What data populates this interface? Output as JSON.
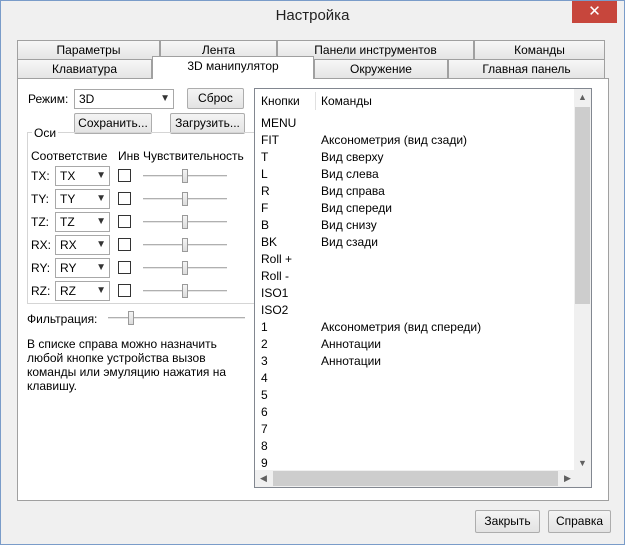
{
  "window": {
    "title": "Настройка",
    "close_glyph": "✕"
  },
  "tabs": {
    "row1": [
      "Параметры",
      "Лента",
      "Панели инструментов",
      "Команды"
    ],
    "row2": [
      "Клавиатура",
      "3D манипулятор",
      "Окружение",
      "Главная панель"
    ],
    "active": "3D манипулятор"
  },
  "mode": {
    "label": "Режим:",
    "value": "3D",
    "reset": "Сброс",
    "save": "Сохранить...",
    "load": "Загрузить..."
  },
  "axes": {
    "group_title": "Оси",
    "col_mapping": "Соответствие",
    "col_invert": "Инв",
    "col_sensitivity": "Чувствительность",
    "rows": [
      {
        "label": "TX:",
        "value": "TX",
        "inverted": false,
        "sensitivity": 0.5
      },
      {
        "label": "TY:",
        "value": "TY",
        "inverted": false,
        "sensitivity": 0.5
      },
      {
        "label": "TZ:",
        "value": "TZ",
        "inverted": false,
        "sensitivity": 0.5
      },
      {
        "label": "RX:",
        "value": "RX",
        "inverted": false,
        "sensitivity": 0.5
      },
      {
        "label": "RY:",
        "value": "RY",
        "inverted": false,
        "sensitivity": 0.5
      },
      {
        "label": "RZ:",
        "value": "RZ",
        "inverted": false,
        "sensitivity": 0.5
      }
    ]
  },
  "filter": {
    "label": "Фильтрация:",
    "level": 0.15
  },
  "info_text": "В списке справа можно назначить любой кнопке устройства вызов команды или эмуляцию нажатия на клавишу.",
  "list": {
    "col_buttons": "Кнопки",
    "col_commands": "Команды",
    "rows": [
      {
        "k": "MENU",
        "c": ""
      },
      {
        "k": "FIT",
        "c": "Аксонометрия (вид сзади)"
      },
      {
        "k": "T",
        "c": "Вид сверху"
      },
      {
        "k": "L",
        "c": "Вид слева"
      },
      {
        "k": "R",
        "c": "Вид справа"
      },
      {
        "k": "F",
        "c": "Вид спереди"
      },
      {
        "k": "B",
        "c": "Вид снизу"
      },
      {
        "k": "BK",
        "c": "Вид сзади"
      },
      {
        "k": "Roll +",
        "c": ""
      },
      {
        "k": "Roll -",
        "c": ""
      },
      {
        "k": "ISO1",
        "c": ""
      },
      {
        "k": "ISO2",
        "c": ""
      },
      {
        "k": "1",
        "c": "Аксонометрия (вид спереди)"
      },
      {
        "k": "2",
        "c": "Аннотации"
      },
      {
        "k": "3",
        "c": "Аннотации"
      },
      {
        "k": "4",
        "c": ""
      },
      {
        "k": "5",
        "c": ""
      },
      {
        "k": "6",
        "c": ""
      },
      {
        "k": "7",
        "c": ""
      },
      {
        "k": "8",
        "c": ""
      },
      {
        "k": "9",
        "c": ""
      }
    ]
  },
  "footer": {
    "close": "Закрыть",
    "help": "Справка"
  },
  "icons": {
    "dropdown": "chevron-down-icon",
    "scroll_up": "arrow-up-icon",
    "scroll_down": "arrow-down-icon",
    "scroll_left": "arrow-left-icon",
    "scroll_right": "arrow-right-icon"
  },
  "colors": {
    "close_button": "#c7463c",
    "window_border": "#7a9cc9"
  }
}
